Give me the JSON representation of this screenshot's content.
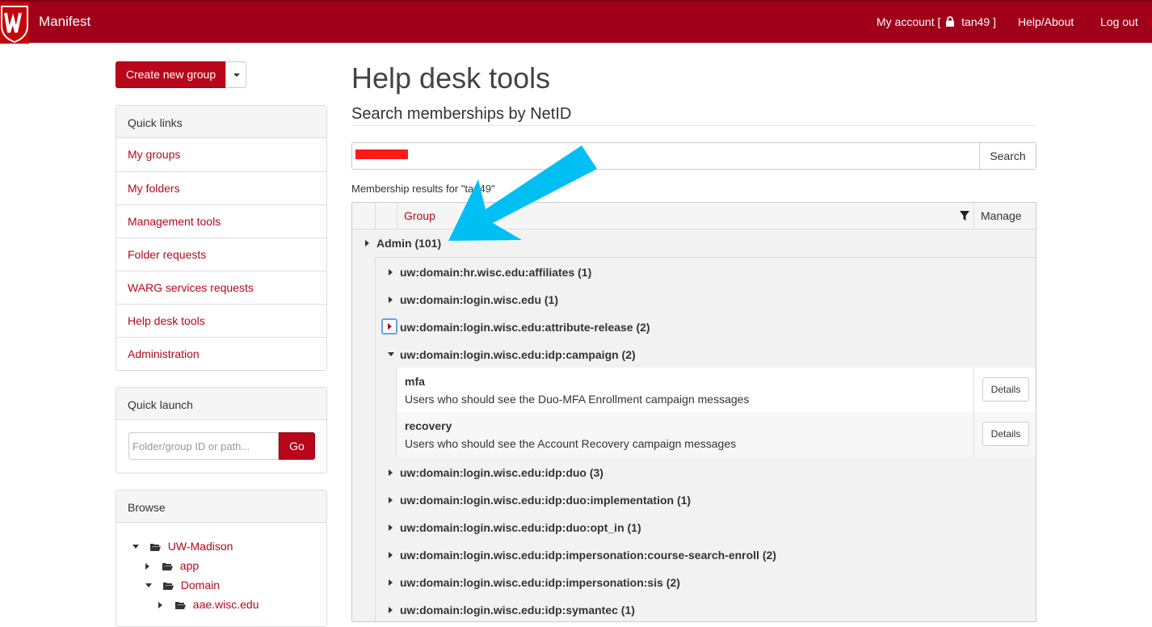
{
  "header": {
    "app_name": "Manifest",
    "account_prefix": "My account [",
    "account_user": "tan49 ]",
    "help": "Help/About",
    "logout": "Log out"
  },
  "sidebar": {
    "create_button": "Create new group",
    "quick_links_title": "Quick links",
    "quick_links": [
      "My groups",
      "My folders",
      "Management tools",
      "Folder requests",
      "WARG services requests",
      "Help desk tools",
      "Administration"
    ],
    "quick_launch_title": "Quick launch",
    "quick_launch_placeholder": "Folder/group ID or path...",
    "go_button": "Go",
    "browse_title": "Browse",
    "tree": [
      "UW-Madison",
      "app",
      "Domain",
      "aae.wisc.edu"
    ]
  },
  "main": {
    "title": "Help desk tools",
    "section": "Search memberships by NetID",
    "search_button": "Search",
    "results_label": "Membership results for \"tan49\"",
    "columns": {
      "group": "Group",
      "manage": "Manage"
    },
    "top_group": "Admin (101)",
    "groups": [
      "uw:domain:hr.wisc.edu:affiliates (1)",
      "uw:domain:login.wisc.edu (1)",
      "uw:domain:login.wisc.edu:attribute-release (2)",
      "uw:domain:login.wisc.edu:idp:campaign (2)",
      "uw:domain:login.wisc.edu:idp:duo (3)",
      "uw:domain:login.wisc.edu:idp:duo:implementation (1)",
      "uw:domain:login.wisc.edu:idp:duo:opt_in (1)",
      "uw:domain:login.wisc.edu:idp:impersonation:course-search-enroll (2)",
      "uw:domain:login.wisc.edu:idp:impersonation:sis (2)",
      "uw:domain:login.wisc.edu:idp:symantec (1)"
    ],
    "members": [
      {
        "name": "mfa",
        "description": "Users who should see the Duo-MFA Enrollment campaign messages",
        "action": "Details"
      },
      {
        "name": "recovery",
        "description": "Users who should see the Account Recovery campaign messages",
        "action": "Details"
      }
    ]
  },
  "colors": {
    "brand": "#a0001a",
    "link": "#b8071a",
    "annotation_arrow": "#00bff3",
    "redaction": "#ff1a1a"
  }
}
